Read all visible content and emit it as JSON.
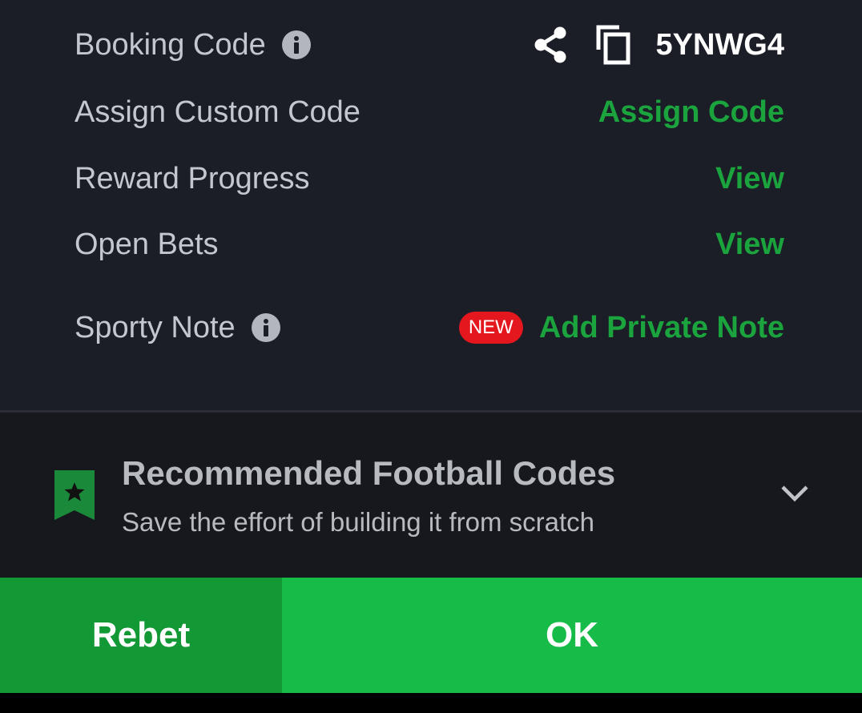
{
  "details": {
    "booking_code": {
      "label": "Booking Code",
      "code": "5YNWG4"
    },
    "custom_code": {
      "label": "Assign Custom Code",
      "action": "Assign Code"
    },
    "reward_progress": {
      "label": "Reward Progress",
      "action": "View"
    },
    "open_bets": {
      "label": "Open Bets",
      "action": "View"
    },
    "sporty_note": {
      "label": "Sporty Note",
      "badge": "NEW",
      "action": "Add Private Note"
    }
  },
  "recommended": {
    "title": "Recommended Football Codes",
    "subtitle": "Save the effort of building it from scratch"
  },
  "buttons": {
    "rebet": "Rebet",
    "ok": "OK"
  },
  "icons": {
    "info": "info-icon",
    "share": "share-icon",
    "copy": "copy-icon",
    "bookmark": "bookmark-star-icon",
    "chevron": "chevron-down-icon"
  },
  "colors": {
    "panel_bg": "#1b1e27",
    "link_green": "#1ba33e",
    "rebet_green": "#129834",
    "ok_green": "#16bb48",
    "badge_red": "#e4161e"
  }
}
